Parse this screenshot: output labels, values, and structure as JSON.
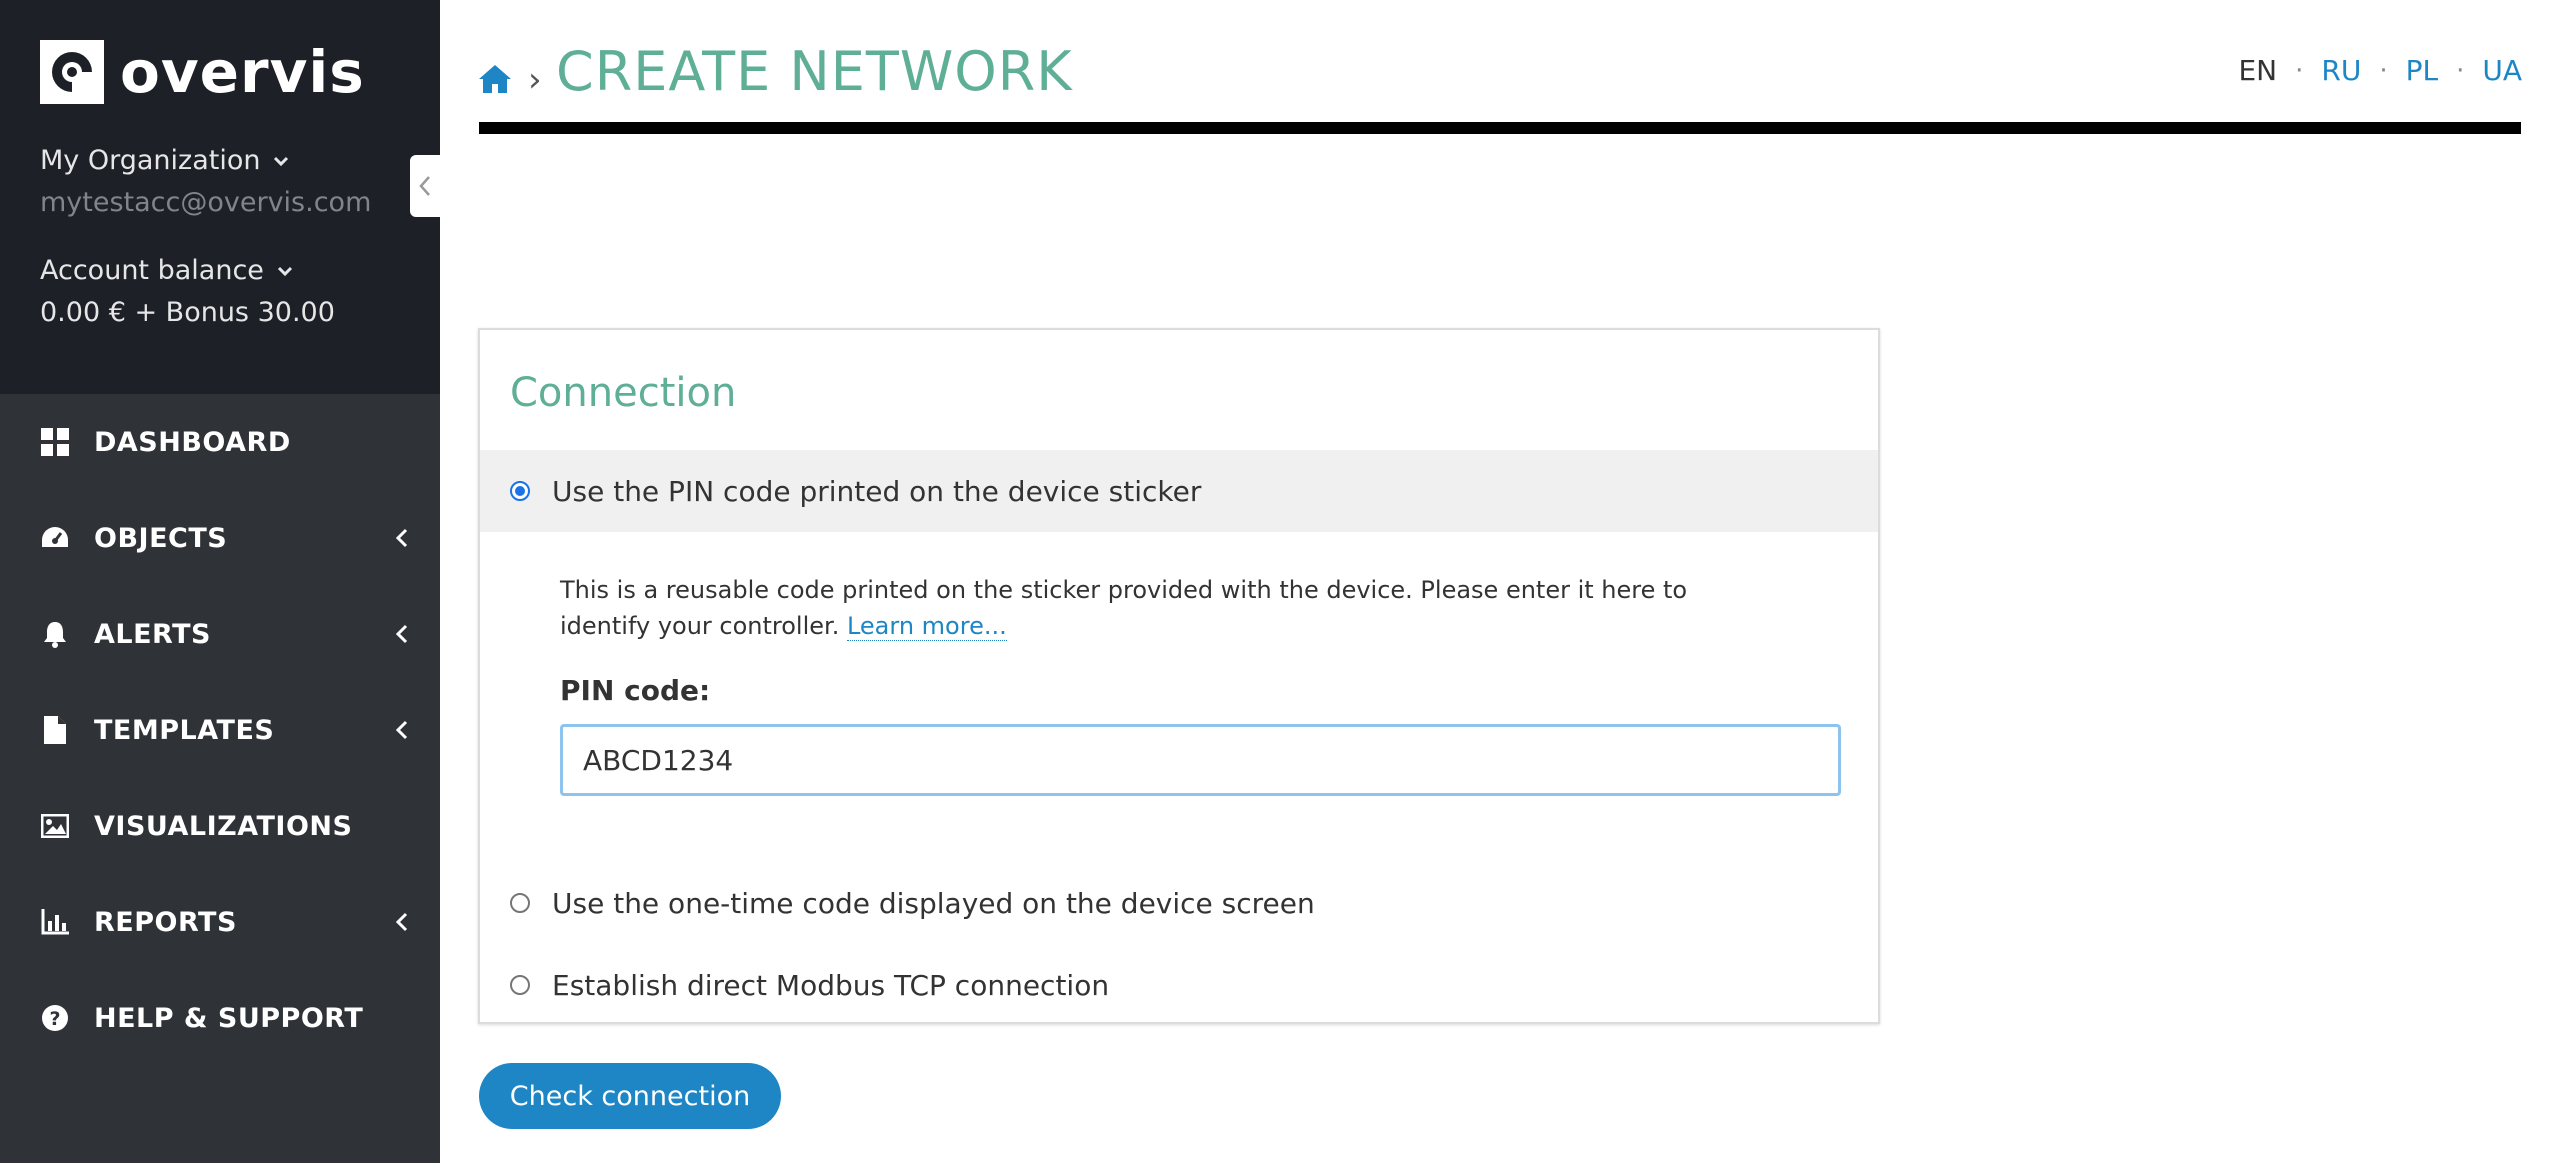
{
  "brand": {
    "name": "overvis"
  },
  "account": {
    "org_name": "My Organization",
    "email": "mytestacc@overvis.com",
    "balance_label": "Account balance",
    "balance_value": "0.00 € + Bonus 30.00"
  },
  "menu": [
    {
      "label": "DASHBOARD",
      "icon": "dashboard-icon",
      "has_arrow": false
    },
    {
      "label": "OBJECTS",
      "icon": "gauge-icon",
      "has_arrow": true
    },
    {
      "label": "ALERTS",
      "icon": "bell-icon",
      "has_arrow": true
    },
    {
      "label": "TEMPLATES",
      "icon": "file-icon",
      "has_arrow": true
    },
    {
      "label": "VISUALIZATIONS",
      "icon": "image-icon",
      "has_arrow": false
    },
    {
      "label": "REPORTS",
      "icon": "bar-chart-icon",
      "has_arrow": true
    },
    {
      "label": "HELP & SUPPORT",
      "icon": "question-icon",
      "has_arrow": false
    }
  ],
  "header": {
    "breadcrumb_sep": "›",
    "title": "CREATE NETWORK"
  },
  "languages": {
    "active": "EN",
    "others": [
      "RU",
      "PL",
      "UA"
    ],
    "separator": "·"
  },
  "connection": {
    "title": "Connection",
    "option_pin": "Use the PIN code printed on the device sticker",
    "option_pin_desc": "This is a reusable code printed on the sticker provided with the device. Please enter it here to identify your controller.",
    "learn_more": "Learn more...",
    "pin_label": "PIN code:",
    "pin_value": "ABCD1234",
    "option_onetime": "Use the one-time code displayed on the device screen",
    "option_modbus": "Establish direct Modbus TCP connection",
    "selected": "pin"
  },
  "actions": {
    "check_connection": "Check connection"
  },
  "colors": {
    "sidebar_top": "#1d2027",
    "sidebar_menu": "#2f3237",
    "accent_green": "#5fae96",
    "link_blue": "#1e86c4",
    "radio_blue": "#1a73e8"
  }
}
